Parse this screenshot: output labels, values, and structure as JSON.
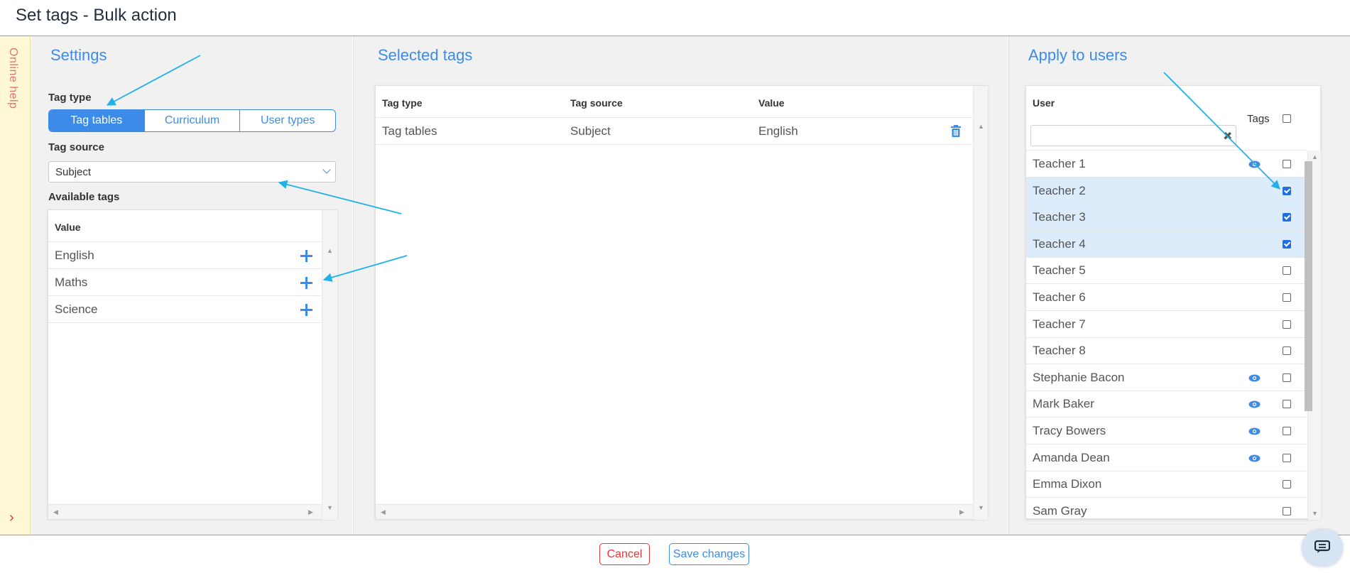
{
  "header": {
    "title": "Set tags - Bulk action"
  },
  "help": {
    "label": "Online help"
  },
  "settings": {
    "title": "Settings",
    "tag_type_label": "Tag type",
    "tag_types": [
      "Tag tables",
      "Curriculum",
      "User types"
    ],
    "tag_type_selected": "Tag tables",
    "tag_source_label": "Tag source",
    "tag_source_value": "Subject",
    "available_label": "Available tags",
    "available_header": "Value",
    "available_rows": [
      "English",
      "Maths",
      "Science"
    ]
  },
  "selected": {
    "title": "Selected tags",
    "headers": [
      "Tag type",
      "Tag source",
      "Value"
    ],
    "rows": [
      {
        "type": "Tag tables",
        "source": "Subject",
        "value": "English"
      }
    ]
  },
  "users": {
    "title": "Apply to users",
    "header_user": "User",
    "header_tags": "Tags",
    "search_value": "",
    "rows": [
      {
        "name": "Teacher 1",
        "eye": true,
        "checked": false
      },
      {
        "name": "Teacher 2",
        "eye": false,
        "checked": true
      },
      {
        "name": "Teacher 3",
        "eye": false,
        "checked": true
      },
      {
        "name": "Teacher 4",
        "eye": false,
        "checked": true
      },
      {
        "name": "Teacher 5",
        "eye": false,
        "checked": false
      },
      {
        "name": "Teacher 6",
        "eye": false,
        "checked": false
      },
      {
        "name": "Teacher 7",
        "eye": false,
        "checked": false
      },
      {
        "name": "Teacher 8",
        "eye": false,
        "checked": false
      },
      {
        "name": "Stephanie Bacon",
        "eye": true,
        "checked": false
      },
      {
        "name": "Mark Baker",
        "eye": true,
        "checked": false
      },
      {
        "name": "Tracy Bowers",
        "eye": true,
        "checked": false
      },
      {
        "name": "Amanda Dean",
        "eye": true,
        "checked": false
      },
      {
        "name": "Emma Dixon",
        "eye": false,
        "checked": false
      },
      {
        "name": "Sam Gray",
        "eye": false,
        "checked": false
      }
    ]
  },
  "footer": {
    "cancel_label": "Cancel",
    "save_label": "Save changes"
  },
  "colors": {
    "accent": "#3d8be8",
    "danger": "#e53935",
    "highlight": "#ddecfb",
    "help_bg": "#fff8d6",
    "annotation": "#1fb2ea"
  }
}
